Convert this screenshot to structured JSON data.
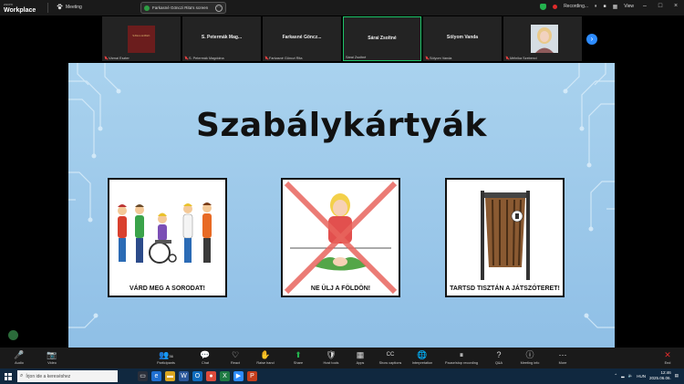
{
  "titlebar": {
    "brand_small": "zoom",
    "brand_big": "Workplace",
    "meeting_label": "Meeting",
    "share_status": "Farkasné Gönczi Rita's screen",
    "recording_label": "Recording...",
    "view_label": "View",
    "minimize": "–",
    "maximize": "□",
    "close": "×"
  },
  "gallery": {
    "tiles": [
      {
        "name": "",
        "label": "Várnai Eszter",
        "thumb": "book-cover",
        "book_text": "SZELLEMEK"
      },
      {
        "name": "S. Petermák Mag...",
        "label": "S. Petermák Magdolna"
      },
      {
        "name": "Farkasné Göncz...",
        "label": "Farkasné Gönczi Rita"
      },
      {
        "name": "Sárai Zsoltné",
        "label": "Sárai Zsoltné",
        "active": true
      },
      {
        "name": "Sólyom Vanda",
        "label": "Sólyom Vanda"
      },
      {
        "name": "",
        "label": "Mélnika Szebenci",
        "thumb": "photo"
      }
    ],
    "next_glyph": "›"
  },
  "slide": {
    "title": "Szabálykártyák",
    "cards": [
      {
        "caption": "VÁRD MEG A SORODAT!"
      },
      {
        "caption": "NE ÜLJ A FÖLDÖN!"
      },
      {
        "caption": "TARTSD TISZTÁN A JÁTSZÓTERET!"
      }
    ]
  },
  "toolbar": {
    "items": [
      {
        "id": "audio",
        "label": "Audio",
        "icon": "🎤"
      },
      {
        "id": "video",
        "label": "Video",
        "icon": "📷"
      },
      {
        "id": "participants",
        "label": "Participants",
        "icon": "👥",
        "count": "36"
      },
      {
        "id": "chat",
        "label": "Chat",
        "icon": "💬"
      },
      {
        "id": "react",
        "label": "React",
        "icon": "♡"
      },
      {
        "id": "raise-hand",
        "label": "Raise hand",
        "icon": "✋"
      },
      {
        "id": "share",
        "label": "Share",
        "icon": "⬆"
      },
      {
        "id": "host-tools",
        "label": "Host tools",
        "icon": "🛡"
      },
      {
        "id": "apps",
        "label": "Apps",
        "icon": "▦"
      },
      {
        "id": "show-captions",
        "label": "Show captions",
        "icon": "CC"
      },
      {
        "id": "interpretation",
        "label": "Interpretation",
        "icon": "🌐"
      },
      {
        "id": "recording",
        "label": "Pause/stop recording",
        "icon": "⏸"
      },
      {
        "id": "qa",
        "label": "Q&A",
        "icon": "?"
      },
      {
        "id": "meeting-info",
        "label": "Meeting info",
        "icon": "ⓘ"
      },
      {
        "id": "more",
        "label": "More",
        "icon": "⋯"
      },
      {
        "id": "end",
        "label": "End",
        "icon": "✕"
      }
    ]
  },
  "taskbar": {
    "search_placeholder": "Írjon ide a kereséshez",
    "lang": "HUN",
    "time": "12:46",
    "date": "2025.06.06.",
    "colors": {
      "background": "#10283f",
      "accent": "#2d8cff"
    }
  }
}
